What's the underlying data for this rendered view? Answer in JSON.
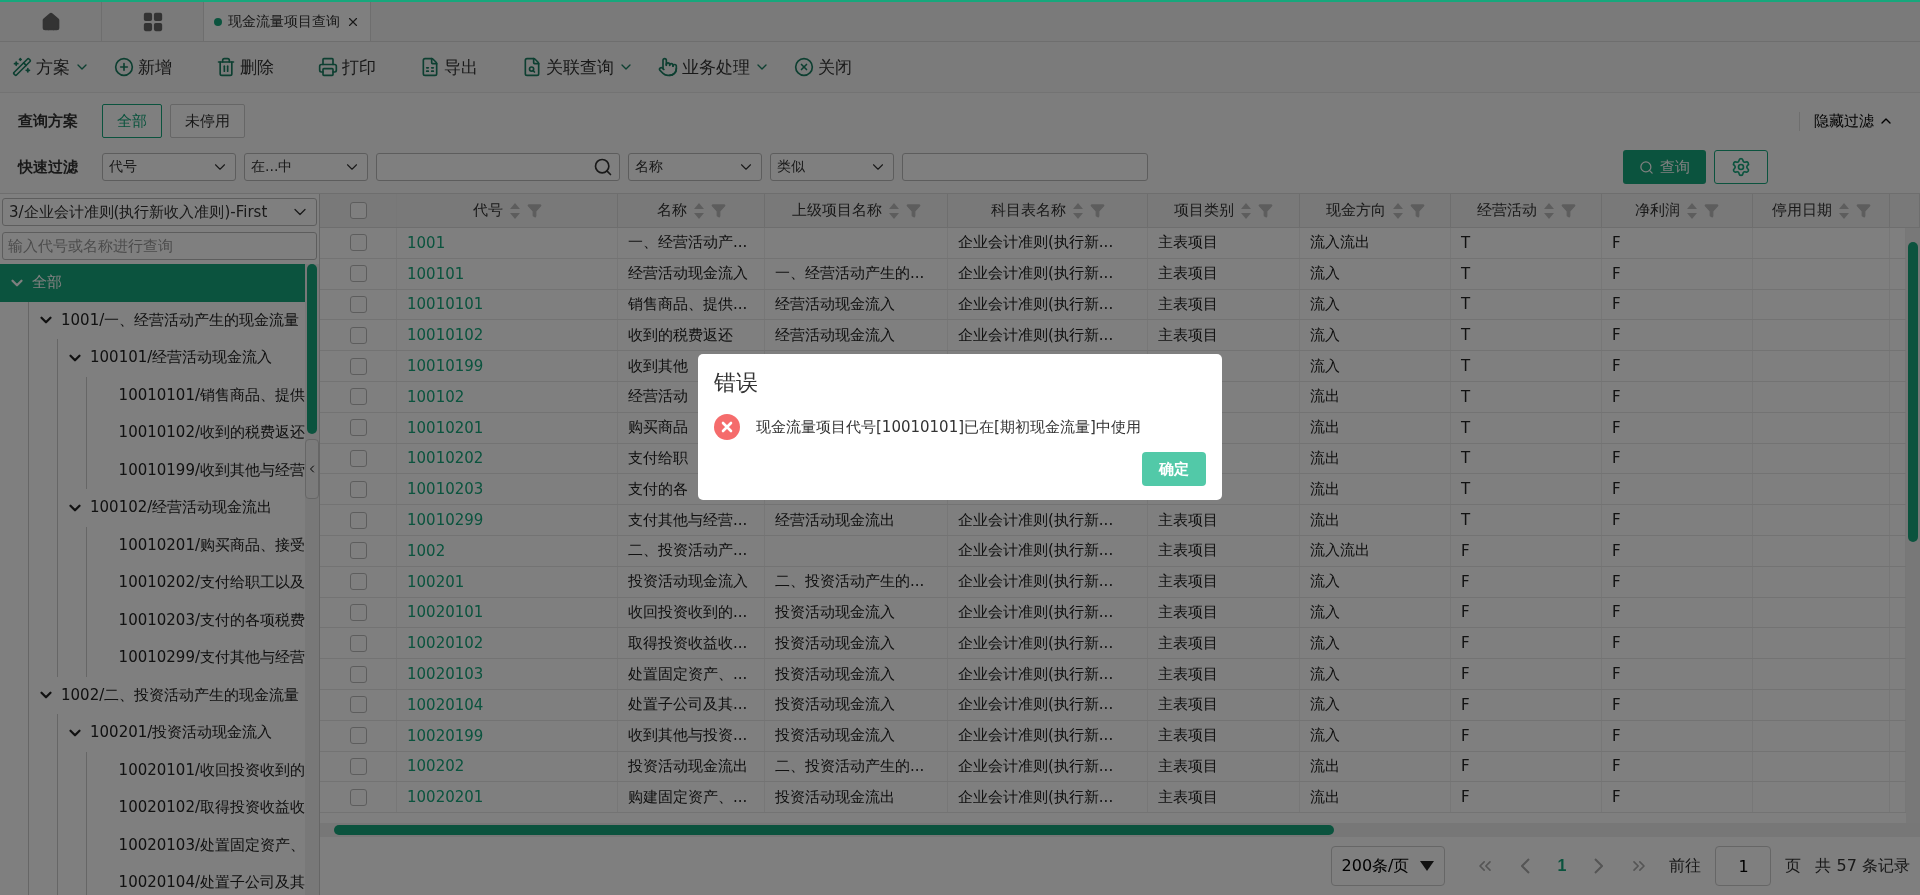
{
  "tabs": [
    {
      "label": "现金流量项目查询",
      "selected": true
    }
  ],
  "toolbar": [
    {
      "label": "方案",
      "dropdown": true
    },
    {
      "label": "新增",
      "dropdown": false
    },
    {
      "label": "删除",
      "dropdown": false
    },
    {
      "label": "打印",
      "dropdown": false
    },
    {
      "label": "导出",
      "dropdown": false
    },
    {
      "label": "关联查询",
      "dropdown": true
    },
    {
      "label": "业务处理",
      "dropdown": true
    },
    {
      "label": "关闭",
      "dropdown": false
    }
  ],
  "plan": {
    "label": "查询方案",
    "options": [
      {
        "label": "全部",
        "selected": true
      },
      {
        "label": "未停用",
        "selected": false
      }
    ],
    "toggle": "隐藏过滤"
  },
  "quick_filter": {
    "label": "快速过滤",
    "fields": [
      {
        "kind": "select",
        "value": "代号"
      },
      {
        "kind": "select",
        "value": "在...中"
      },
      {
        "kind": "search"
      },
      {
        "kind": "select",
        "value": "名称"
      },
      {
        "kind": "select",
        "value": "类似"
      },
      {
        "kind": "input"
      }
    ],
    "query_button": "查询"
  },
  "sidebar": {
    "scheme": "3/企业会计准则(执行新收入准则)-First",
    "search_placeholder": "输入代号或名称进行查询",
    "tree": [
      {
        "label": "全部",
        "selected": true,
        "expanded": true,
        "children": [
          {
            "label": "1001/一、经营活动产生的现金流量",
            "selected": false,
            "expanded": true,
            "children": [
              {
                "label": "100101/经营活动现金流入",
                "selected": false,
                "expanded": true,
                "children": [
                  {
                    "label": "10010101/销售商品、提供",
                    "selected": false
                  },
                  {
                    "label": "10010102/收到的税费返还",
                    "selected": false
                  },
                  {
                    "label": "10010199/收到其他与经营",
                    "selected": false
                  }
                ]
              },
              {
                "label": "100102/经营活动现金流出",
                "selected": false,
                "expanded": true,
                "children": [
                  {
                    "label": "10010201/购买商品、接受",
                    "selected": false
                  },
                  {
                    "label": "10010202/支付给职工以及",
                    "selected": false
                  },
                  {
                    "label": "10010203/支付的各项税费",
                    "selected": false
                  },
                  {
                    "label": "10010299/支付其他与经营",
                    "selected": false
                  }
                ]
              }
            ]
          },
          {
            "label": "1002/二、投资活动产生的现金流量",
            "selected": false,
            "expanded": true,
            "children": [
              {
                "label": "100201/投资活动现金流入",
                "selected": false,
                "expanded": true,
                "children": [
                  {
                    "label": "10020101/收回投资收到的",
                    "selected": false
                  },
                  {
                    "label": "10020102/取得投资收益收",
                    "selected": false
                  },
                  {
                    "label": "10020103/处置固定资产、",
                    "selected": false
                  },
                  {
                    "label": "10020104/处置子公司及其",
                    "selected": false
                  }
                ]
              }
            ]
          }
        ]
      }
    ]
  },
  "table": {
    "header_checked": false,
    "columns": [
      "代号",
      "名称",
      "上级项目名称",
      "科目表名称",
      "项目类别",
      "现金方向",
      "经营活动",
      "净利润",
      "停用日期"
    ],
    "rows": [
      {
        "checked": false,
        "cells": [
          "1001",
          "一、经营活动产...",
          null,
          "企业会计准则(执行新...",
          "主表项目",
          "流入流出",
          "T",
          "F",
          null
        ]
      },
      {
        "checked": false,
        "cells": [
          "100101",
          "经营活动现金流入",
          "一、经营活动产生的...",
          "企业会计准则(执行新...",
          "主表项目",
          "流入",
          "T",
          "F",
          null
        ]
      },
      {
        "checked": false,
        "cells": [
          "10010101",
          "销售商品、提供...",
          "经营活动现金流入",
          "企业会计准则(执行新...",
          "主表项目",
          "流入",
          "T",
          "F",
          null
        ]
      },
      {
        "checked": false,
        "cells": [
          "10010102",
          "收到的税费返还",
          "经营活动现金流入",
          "企业会计准则(执行新...",
          "主表项目",
          "流入",
          "T",
          "F",
          null
        ]
      },
      {
        "checked": false,
        "cells": [
          "10010199",
          "收到其他",
          null,
          null,
          null,
          "流入",
          "T",
          "F",
          null
        ]
      },
      {
        "checked": false,
        "cells": [
          "100102",
          "经营活动",
          null,
          null,
          null,
          "流出",
          "T",
          "F",
          null
        ]
      },
      {
        "checked": false,
        "cells": [
          "10010201",
          "购买商品",
          null,
          null,
          null,
          "流出",
          "T",
          "F",
          null
        ]
      },
      {
        "checked": false,
        "cells": [
          "10010202",
          "支付给职",
          null,
          null,
          null,
          "流出",
          "T",
          "F",
          null
        ]
      },
      {
        "checked": false,
        "cells": [
          "10010203",
          "支付的各",
          null,
          null,
          null,
          "流出",
          "T",
          "F",
          null
        ]
      },
      {
        "checked": false,
        "cells": [
          "10010299",
          "支付其他与经营...",
          "经营活动现金流出",
          "企业会计准则(执行新...",
          "主表项目",
          "流出",
          "T",
          "F",
          null
        ]
      },
      {
        "checked": false,
        "cells": [
          "1002",
          "二、投资活动产...",
          null,
          "企业会计准则(执行新...",
          "主表项目",
          "流入流出",
          "F",
          "F",
          null
        ]
      },
      {
        "checked": false,
        "cells": [
          "100201",
          "投资活动现金流入",
          "二、投资活动产生的...",
          "企业会计准则(执行新...",
          "主表项目",
          "流入",
          "F",
          "F",
          null
        ]
      },
      {
        "checked": false,
        "cells": [
          "10020101",
          "收回投资收到的...",
          "投资活动现金流入",
          "企业会计准则(执行新...",
          "主表项目",
          "流入",
          "F",
          "F",
          null
        ]
      },
      {
        "checked": false,
        "cells": [
          "10020102",
          "取得投资收益收...",
          "投资活动现金流入",
          "企业会计准则(执行新...",
          "主表项目",
          "流入",
          "F",
          "F",
          null
        ]
      },
      {
        "checked": false,
        "cells": [
          "10020103",
          "处置固定资产、...",
          "投资活动现金流入",
          "企业会计准则(执行新...",
          "主表项目",
          "流入",
          "F",
          "F",
          null
        ]
      },
      {
        "checked": false,
        "cells": [
          "10020104",
          "处置子公司及其...",
          "投资活动现金流入",
          "企业会计准则(执行新...",
          "主表项目",
          "流入",
          "F",
          "F",
          null
        ]
      },
      {
        "checked": false,
        "cells": [
          "10020199",
          "收到其他与投资...",
          "投资活动现金流入",
          "企业会计准则(执行新...",
          "主表项目",
          "流入",
          "F",
          "F",
          null
        ]
      },
      {
        "checked": false,
        "cells": [
          "100202",
          "投资活动现金流出",
          "二、投资活动产生的...",
          "企业会计准则(执行新...",
          "主表项目",
          "流出",
          "F",
          "F",
          null
        ]
      },
      {
        "checked": false,
        "cells": [
          "10020201",
          "购建固定资产、...",
          "投资活动现金流出",
          "企业会计准则(执行新...",
          "主表项目",
          "流出",
          "F",
          "F",
          null
        ]
      }
    ]
  },
  "pagination": {
    "page_size": "200条/页",
    "pages": [
      {
        "label": "1",
        "selected": true
      }
    ],
    "goto_label": "前往",
    "goto_value": "1",
    "page_unit": "页",
    "total": "共 57 条记录"
  },
  "dialog": {
    "title": "错误",
    "message": "现金流量项目代号[10010101]已在[期初现金流量]中使用",
    "ok": "确定"
  }
}
